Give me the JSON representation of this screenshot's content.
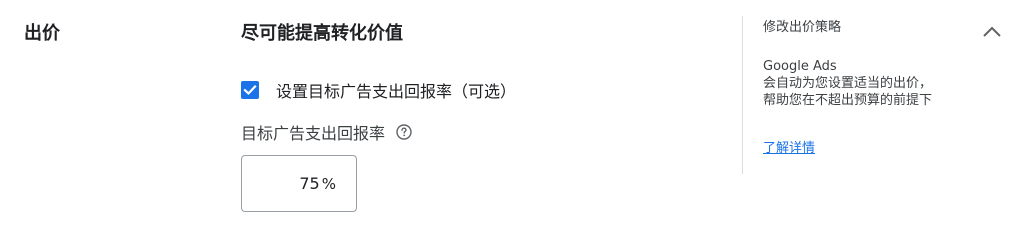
{
  "section": {
    "label": "出价"
  },
  "strategy": {
    "title": "尽可能提高转化价值",
    "checkbox_label": "设置目标广告支出回报率（可选）",
    "checkbox_checked": true,
    "field_label": "目标广告支出回报率",
    "help_icon": "help-circle-icon",
    "roas_value": "75",
    "roas_unit": "%"
  },
  "sidebar": {
    "title": "修改出价策略",
    "desc_line1": "Google Ads",
    "desc_line2": "会自动为您设置适当的出价，",
    "desc_line3": "帮助您在不超出预算的前提下",
    "learn_more": "了解详情",
    "collapse_icon": "chevron-up-icon"
  },
  "colors": {
    "accent": "#1a73e8",
    "text": "#202124",
    "divider": "#dadce0"
  }
}
